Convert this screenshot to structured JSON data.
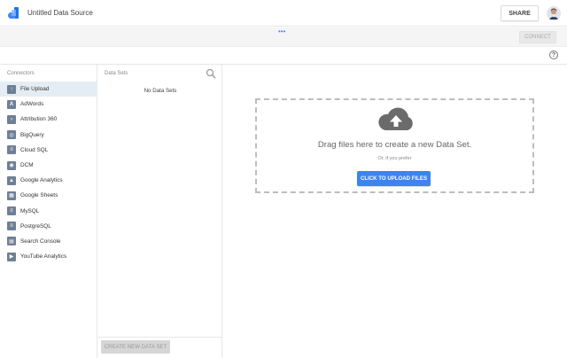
{
  "header": {
    "title": "Untitled Data Source",
    "share_label": "SHARE",
    "logo_icon": "data-studio-logo-icon",
    "avatar_icon": "user-avatar"
  },
  "toolbar": {
    "drag_handle": "•••",
    "connect_label": "CONNECT",
    "help_glyph": "?"
  },
  "connectors": {
    "header": "Connectors",
    "items": [
      {
        "label": "File Upload",
        "icon": "file-upload-icon",
        "glyph": "↑",
        "selected": true
      },
      {
        "label": "AdWords",
        "icon": "adwords-icon",
        "glyph": "A",
        "selected": false
      },
      {
        "label": "Attribution 360",
        "icon": "attribution-icon",
        "glyph": "›",
        "selected": false
      },
      {
        "label": "BigQuery",
        "icon": "bigquery-icon",
        "glyph": "◎",
        "selected": false
      },
      {
        "label": "Cloud SQL",
        "icon": "cloud-sql-icon",
        "glyph": "≡",
        "selected": false
      },
      {
        "label": "DCM",
        "icon": "dcm-icon",
        "glyph": "◉",
        "selected": false
      },
      {
        "label": "Google Analytics",
        "icon": "analytics-icon",
        "glyph": "▲",
        "selected": false
      },
      {
        "label": "Google Sheets",
        "icon": "sheets-icon",
        "glyph": "▦",
        "selected": false
      },
      {
        "label": "MySQL",
        "icon": "mysql-icon",
        "glyph": "≡",
        "selected": false
      },
      {
        "label": "PostgreSQL",
        "icon": "postgresql-icon",
        "glyph": "≡",
        "selected": false
      },
      {
        "label": "Search Console",
        "icon": "search-console-icon",
        "glyph": "▤",
        "selected": false
      },
      {
        "label": "YouTube Analytics",
        "icon": "youtube-icon",
        "glyph": "▶",
        "selected": false
      }
    ]
  },
  "datasets": {
    "header": "Data Sets",
    "empty_text": "No Data Sets",
    "create_label": "CREATE NEW DATA SET"
  },
  "upload": {
    "title": "Drag files here to create a new Data Set.",
    "subtitle": "Or, if you prefer",
    "button_label": "CLICK TO UPLOAD FILES"
  },
  "colors": {
    "accent": "#3c84f0",
    "selected_row": "#e4edf3",
    "connector_icon": "#6f7f95"
  }
}
